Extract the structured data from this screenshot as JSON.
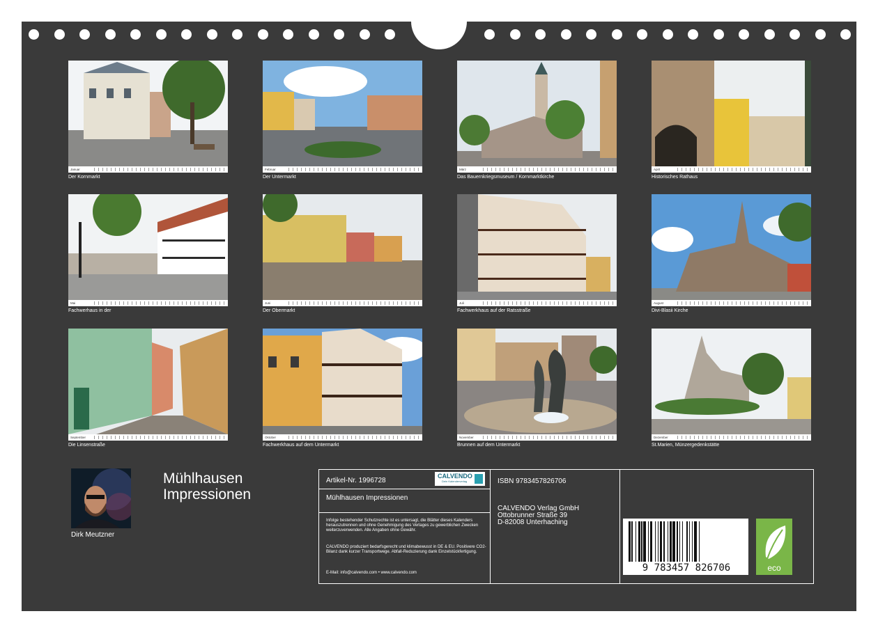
{
  "title_line1": "Mühlhausen",
  "title_line2": "Impressionen",
  "author": "Dirk Meutzner",
  "months": [
    {
      "name": "Januar",
      "caption": "Der Kornmarkt"
    },
    {
      "name": "Februar",
      "caption": "Der Untermarkt"
    },
    {
      "name": "März",
      "caption": "Das Bauernkriegsmuseum / Kornmarktkirche"
    },
    {
      "name": "April",
      "caption": "Historisches Rathaus"
    },
    {
      "name": "Mai",
      "caption": "Fachwerhaus in der"
    },
    {
      "name": "Juni",
      "caption": "Der Obermarkt"
    },
    {
      "name": "Juli",
      "caption": "Fachwerkhaus auf der Ratsstraße"
    },
    {
      "name": "August",
      "caption": "Divi-Blasii Kirche"
    },
    {
      "name": "September",
      "caption": "Die Linsenstraße"
    },
    {
      "name": "Oktober",
      "caption": "Fachwerkhaus auf dem Untermarkt"
    },
    {
      "name": "November",
      "caption": "Brunnen auf dem Untermarkt"
    },
    {
      "name": "Dezember",
      "caption": "St.Marien, Münzergedenkstätte"
    }
  ],
  "info": {
    "article": "Artikel-Nr. 1996728",
    "logo": "CALVENDO",
    "logo_sub": "Dein Kalenderverlag",
    "product_title": "Mühlhausen Impressionen",
    "legal": "Infolge bestehender Schutzrechte ist es untersagt, die Blätter dieses Kalenders herauszutrennen und ohne Genehmigung des Verlages zu gewerblichen Zwecken weiterzuverwenden. Alle Angaben ohne Gewähr.",
    "climate": "CALVENDO produziert bedarfsgerecht und klimabewusst in DE & EU. Positivere CO2-Bilanz dank kurzer Transportwege. Abfall-Reduzierung dank Einzelstückfertigung.",
    "contact": "E-Mail: info@calvendo.com • www.calvendo.com",
    "isbn": "ISBN 9783457826706",
    "publisher_name": "CALVENDO Verlag GmbH",
    "publisher_street": "Ottobrunner Straße 39",
    "publisher_city": "D-82008 Unterhaching",
    "barcode_digits": "9 783457 826706",
    "eco_label": "eco"
  }
}
